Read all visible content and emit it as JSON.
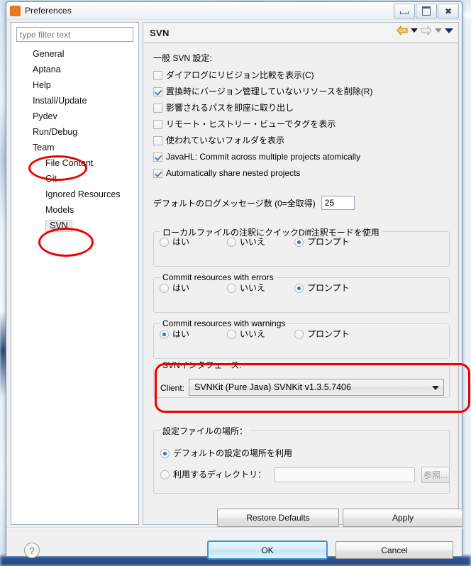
{
  "window": {
    "title": "Preferences",
    "icon": "gear-icon",
    "minimize": "Minimize",
    "maximize": "Maximize",
    "close": "Close"
  },
  "sidebar": {
    "filter_placeholder": "type filter text",
    "items": [
      {
        "label": "General",
        "level": 0,
        "selected": false,
        "highlighted": false
      },
      {
        "label": "Aptana",
        "level": 0,
        "selected": false,
        "highlighted": false
      },
      {
        "label": "Help",
        "level": 0,
        "selected": false,
        "highlighted": false
      },
      {
        "label": "Install/Update",
        "level": 0,
        "selected": false,
        "highlighted": false
      },
      {
        "label": "Pydev",
        "level": 0,
        "selected": false,
        "highlighted": false
      },
      {
        "label": "Run/Debug",
        "level": 0,
        "selected": false,
        "highlighted": false
      },
      {
        "label": "Team",
        "level": 0,
        "selected": false,
        "highlighted": true
      },
      {
        "label": "File Content",
        "level": 1,
        "selected": false,
        "highlighted": false
      },
      {
        "label": "Git",
        "level": 1,
        "selected": false,
        "highlighted": false
      },
      {
        "label": "Ignored Resources",
        "level": 1,
        "selected": false,
        "highlighted": false
      },
      {
        "label": "Models",
        "level": 1,
        "selected": false,
        "highlighted": false
      },
      {
        "label": "SVN",
        "level": 1,
        "selected": true,
        "highlighted": true
      }
    ]
  },
  "pane": {
    "title": "SVN",
    "nav_back": "back-arrow",
    "nav_forward": "forward-arrow",
    "general_label": "一般 SVN 設定:",
    "checkboxes": [
      {
        "label": "ダイアログにリビジョン比較を表示(C)",
        "checked": false
      },
      {
        "label": "置換時にバージョン管理していないリソースを削除(R)",
        "checked": true
      },
      {
        "label": "影響されるパスを即座に取り出し",
        "checked": false
      },
      {
        "label": "リモート・ヒストリー・ビューでタグを表示",
        "checked": false
      },
      {
        "label": "使われていないフォルダを表示",
        "checked": false
      },
      {
        "label": "JavaHL: Commit across multiple projects atomically",
        "checked": true
      },
      {
        "label": "Automatically share nested projects",
        "checked": true
      }
    ],
    "log_messages": {
      "label": "デフォルトのログメッセージ数 (0=全取得)",
      "value": "25"
    },
    "radio_groups": [
      {
        "title": "ローカルファイルの注釈にクイックDiff注釈モードを使用",
        "options": [
          {
            "label": "はい",
            "selected": false
          },
          {
            "label": "いいえ",
            "selected": false
          },
          {
            "label": "プロンプト",
            "selected": true
          }
        ]
      },
      {
        "title": "Commit resources with errors",
        "options": [
          {
            "label": "はい",
            "selected": false
          },
          {
            "label": "いいえ",
            "selected": false
          },
          {
            "label": "プロンプト",
            "selected": true
          }
        ]
      },
      {
        "title": "Commit resources with warnings",
        "options": [
          {
            "label": "はい",
            "selected": true
          },
          {
            "label": "いいえ",
            "selected": false
          },
          {
            "label": "プロンプト",
            "selected": false
          }
        ]
      }
    ],
    "svn_interface": {
      "title": "SVNインタフェース:",
      "client_label": "Client:",
      "client_value": "SVNKit (Pure Java) SVNKit v1.3.5.7406"
    },
    "config_location": {
      "title": "設定ファイルの場所：",
      "option_default": {
        "label": "デフォルトの設定の場所を利用",
        "selected": true
      },
      "option_custom": {
        "label": "利用するディレクトリ：",
        "selected": false
      },
      "path_value": "",
      "browse_label": "参照..."
    },
    "restore_defaults": "Restore Defaults",
    "apply": "Apply"
  },
  "footer": {
    "help": "?",
    "ok": "OK",
    "cancel": "Cancel"
  },
  "colors": {
    "highlight": "#ee0000",
    "accent": "#3c9ad4",
    "title_icon": "#e8761b"
  }
}
